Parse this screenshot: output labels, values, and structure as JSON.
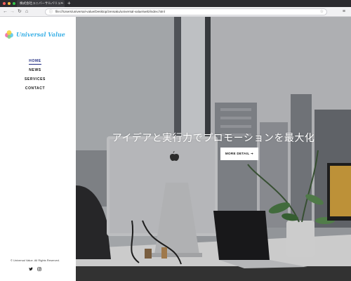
{
  "browser": {
    "tab_title": "株式会社ユニバーサルバリュー",
    "url": "file:///Users/universal-value/Desktop/zensaku/universal-value/web/index.html",
    "traffic_colors": [
      "#fc605c",
      "#fdbc40",
      "#34c84a"
    ]
  },
  "sidebar": {
    "logo_text": "Universal Value",
    "nav": [
      {
        "label": "HOME",
        "active": true
      },
      {
        "label": "NEWS",
        "active": false
      },
      {
        "label": "SERVICES",
        "active": false
      },
      {
        "label": "CONTACT",
        "active": false
      }
    ],
    "copyright": "© Universal Value. All Rights Reserved.",
    "social": [
      "twitter-icon",
      "instagram-icon"
    ]
  },
  "hero": {
    "caption": "アイデアと実行力でプロモーションを最大化",
    "button_label": "MORE DETAIL ➔"
  },
  "colors": {
    "logo": "#3ab0e6",
    "active_nav": "#1e2a80"
  }
}
